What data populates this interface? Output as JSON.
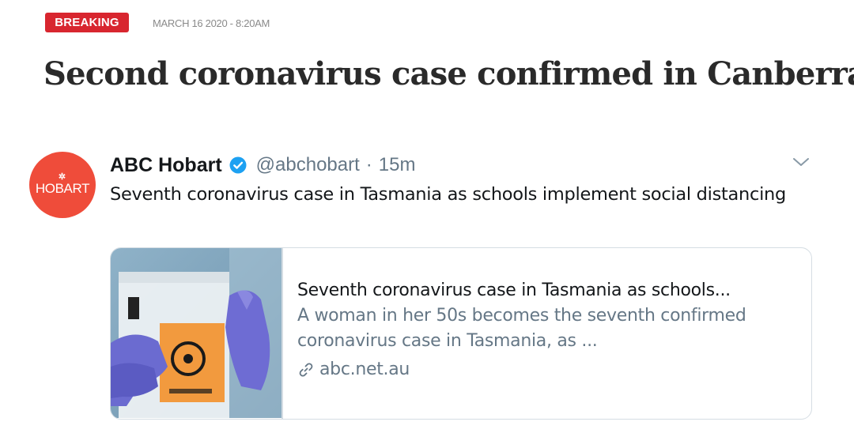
{
  "article": {
    "badge": "BREAKING",
    "dateline": "MARCH 16 2020 - 8:20AM",
    "headline": "Second coronavirus case confirmed in Canberra"
  },
  "tweet": {
    "avatar_text": "HOBART",
    "author_name": "ABC Hobart",
    "handle": "@abchobart",
    "separator": "·",
    "time": "15m",
    "text": "Seventh coronavirus case in Tasmania as schools implement social distancing",
    "card": {
      "title": "Seventh coronavirus case in Tasmania as schools...",
      "description": "A woman in her 50s becomes the seventh confirmed coronavirus case in Tasmania, as ...",
      "domain": "abc.net.au"
    }
  },
  "colors": {
    "badge_red": "#d8262f",
    "avatar_orange": "#ef4c3a",
    "verified_blue": "#1da1f2",
    "muted_gray": "#657786"
  },
  "icons": [
    "verified-badge-icon",
    "chevron-down-icon",
    "link-icon",
    "abc-logo-icon"
  ]
}
